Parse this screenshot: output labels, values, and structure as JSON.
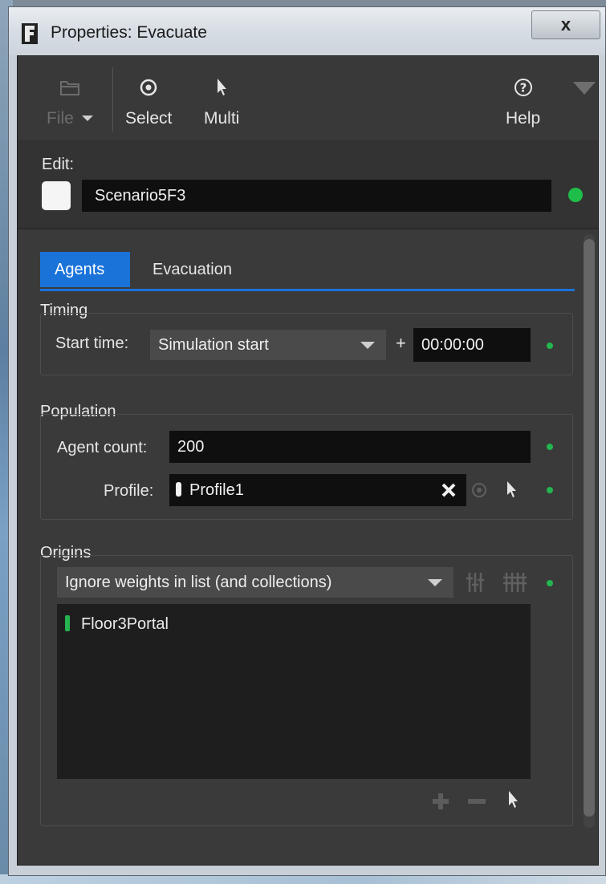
{
  "window": {
    "title": "Properties: Evacuate",
    "close_label": "x"
  },
  "toolbar": {
    "file_label": "File",
    "select_label": "Select",
    "multi_label": "Multi",
    "help_label": "Help"
  },
  "edit": {
    "label": "Edit:",
    "name_value": "Scenario5F3",
    "swatch_color": "#f5f5f5",
    "status_color": "#1fbe4b"
  },
  "tabs": [
    {
      "label": "Agents",
      "active": true
    },
    {
      "label": "Evacuation",
      "active": false
    }
  ],
  "timing": {
    "title": "Timing",
    "start_time_label": "Start time:",
    "start_time_value": "Simulation start",
    "plus": "+",
    "offset_value": "00:00:00"
  },
  "population": {
    "title": "Population",
    "agent_count_label": "Agent count:",
    "agent_count_value": "200",
    "profile_label": "Profile:",
    "profile_value": "Profile1"
  },
  "origins": {
    "title": "Origins",
    "mode_value": "Ignore weights in list (and collections)",
    "items": [
      {
        "label": "Floor3Portal",
        "color": "#24b34f"
      }
    ]
  },
  "colors": {
    "accent": "#1a73d9",
    "status_green": "#23b54f",
    "panel": "#3a3a3a"
  }
}
